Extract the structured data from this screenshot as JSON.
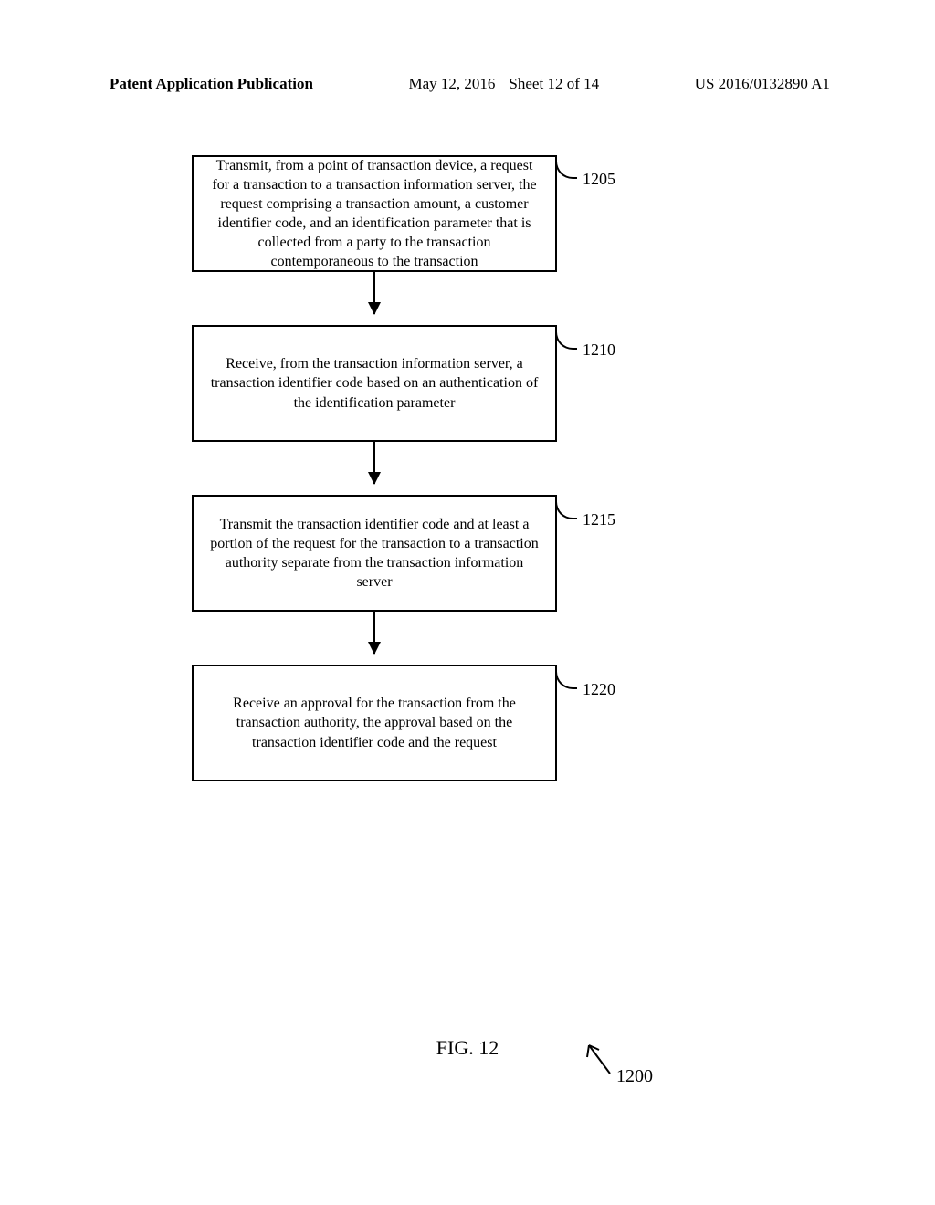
{
  "header": {
    "publication_label": "Patent Application Publication",
    "date": "May 12, 2016",
    "sheet": "Sheet 12 of 14",
    "pub_number": "US 2016/0132890 A1"
  },
  "chart_data": {
    "type": "flowchart",
    "reference_number": "1200",
    "steps": [
      {
        "id": "1205",
        "text": "Transmit, from a point of transaction device, a request for a transaction to a transaction information server, the request comprising a transaction amount, a customer identifier code, and an identification parameter that is collected from a party to the transaction contemporaneous to the transaction"
      },
      {
        "id": "1210",
        "text": "Receive, from the transaction information server, a transaction identifier code based on an authentication of the identification parameter"
      },
      {
        "id": "1215",
        "text": "Transmit the transaction identifier code and at least a portion of the request for the transaction to a transaction authority separate from the transaction information server"
      },
      {
        "id": "1220",
        "text": "Receive an approval for the transaction from the transaction authority, the approval based on the transaction identifier code and the request"
      }
    ]
  },
  "figure_label": "FIG.  12"
}
